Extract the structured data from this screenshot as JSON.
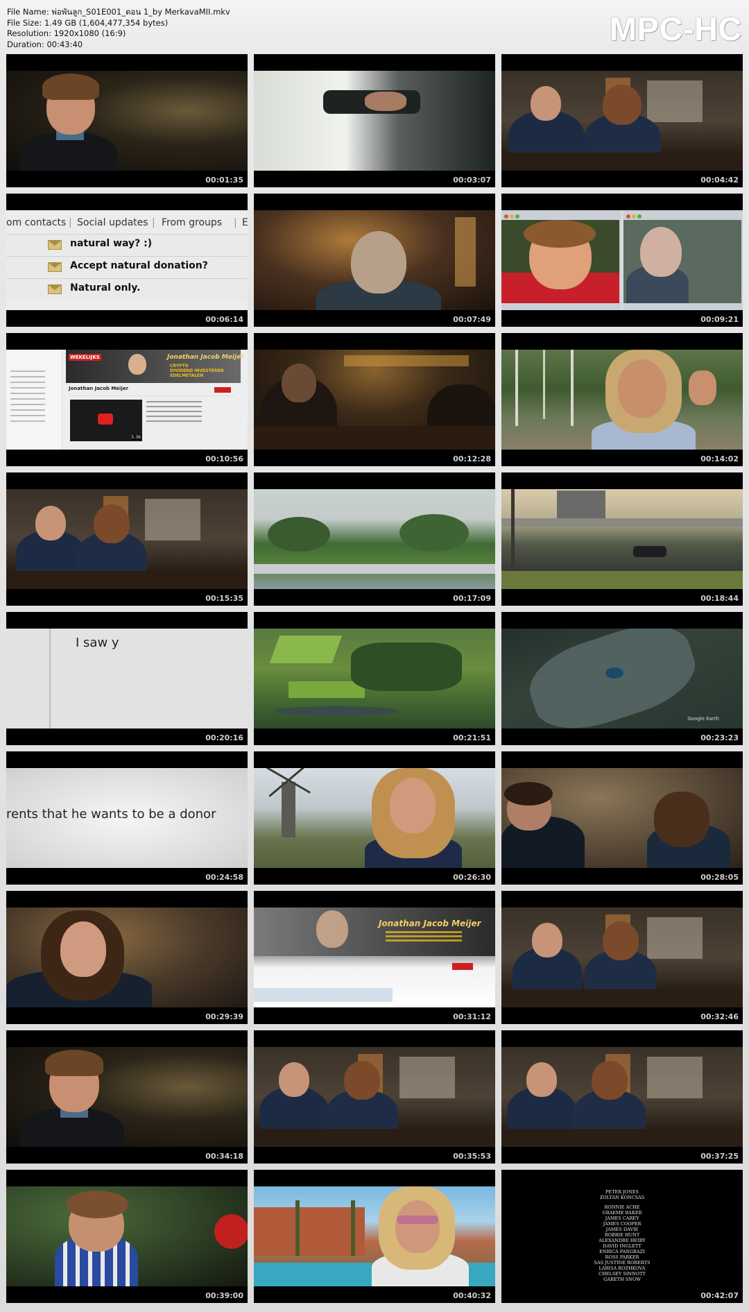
{
  "header": {
    "file_name": "File Name: พ่อพันลูก_S01E001_ตอน 1_by MerkavaMII.mkv",
    "file_size": "File Size: 1.49 GB (1,604,477,354 bytes)",
    "resolution": "Resolution: 1920x1080 (16:9)",
    "duration": "Duration: 00:43:40",
    "logo": "MPC-HC"
  },
  "thumbnails": [
    {
      "timestamp": "00:01:35"
    },
    {
      "timestamp": "00:03:07"
    },
    {
      "timestamp": "00:04:42"
    },
    {
      "timestamp": "00:06:14",
      "tabs": [
        "om contacts",
        "Social updates",
        "From groups",
        "E"
      ],
      "emails": [
        "natural way? :)",
        "Accept natural donation?",
        "Natural only."
      ]
    },
    {
      "timestamp": "00:07:49"
    },
    {
      "timestamp": "00:09:21"
    },
    {
      "timestamp": "00:10:56",
      "banner_name": "Jonathan Jacob Meijer",
      "banner_tag": "WEKELIJKS",
      "banner_items": [
        "CRYPTO",
        "DIVIDEND INVESTEREN",
        "EDELMETALEN"
      ],
      "channel_name": "Jonathan Jacob Meijer",
      "video_length": "5:36"
    },
    {
      "timestamp": "00:12:28"
    },
    {
      "timestamp": "00:14:02"
    },
    {
      "timestamp": "00:15:35"
    },
    {
      "timestamp": "00:17:09"
    },
    {
      "timestamp": "00:18:44"
    },
    {
      "timestamp": "00:20:16",
      "text": "I saw y"
    },
    {
      "timestamp": "00:21:51"
    },
    {
      "timestamp": "00:23:23",
      "watermark": "Google Earth"
    },
    {
      "timestamp": "00:24:58",
      "text": "rents that he wants to be a donor"
    },
    {
      "timestamp": "00:26:30"
    },
    {
      "timestamp": "00:28:05"
    },
    {
      "timestamp": "00:29:39"
    },
    {
      "timestamp": "00:31:12",
      "banner_name": "Jonathan Jacob Meijer"
    },
    {
      "timestamp": "00:32:46"
    },
    {
      "timestamp": "00:34:18"
    },
    {
      "timestamp": "00:35:53"
    },
    {
      "timestamp": "00:37:25"
    },
    {
      "timestamp": "00:39:00"
    },
    {
      "timestamp": "00:40:32"
    },
    {
      "timestamp": "00:42:07",
      "credits": [
        "PETER JONES",
        "ZOLTAN KONCSAS",
        "RONNIE ACHE",
        "GRAEME BAKER",
        "JAMES CAREY",
        "JAMES COOPER",
        "JAMES DAVIE",
        "ROBBIE HUNT",
        "ALEXANDRE HEIBY",
        "DAVID INGLETT",
        "ENRICA PANGRAZI",
        "ROSS PARKER",
        "SAS JUSTINE ROBERTS",
        "LARISA ROZHKOVA",
        "CHELSEY SINNOTT",
        "GARETH SNOW"
      ]
    }
  ]
}
